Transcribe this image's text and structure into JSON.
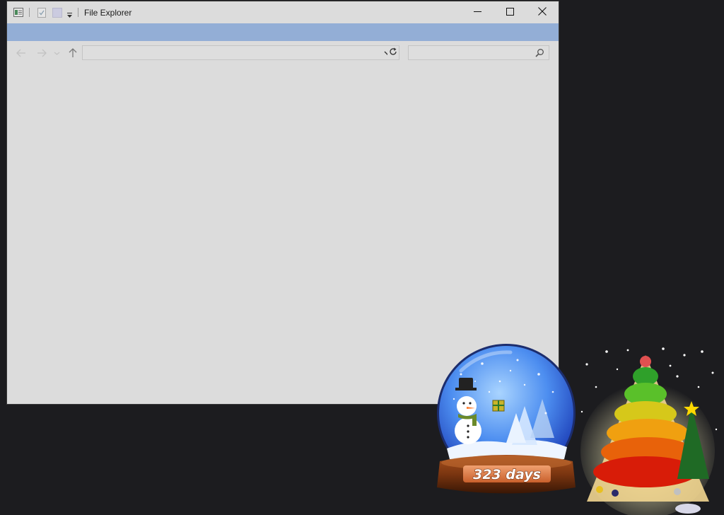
{
  "window": {
    "title": "File Explorer",
    "address_value": "",
    "search_placeholder": ""
  },
  "gadget": {
    "countdown_label": "323 days"
  },
  "colors": {
    "desktop_bg": "#1c1c1f",
    "window_bg": "#dcdcdc",
    "ribbon_band": "#93aed6"
  },
  "icons": [
    "properties-icon",
    "checklist-icon",
    "new-folder-icon",
    "customize-quick-access-icon",
    "minimize-icon",
    "maximize-icon",
    "close-icon",
    "back-arrow-icon",
    "forward-arrow-icon",
    "recent-locations-icon",
    "up-arrow-icon",
    "chevron-down-icon",
    "refresh-icon",
    "search-icon"
  ]
}
